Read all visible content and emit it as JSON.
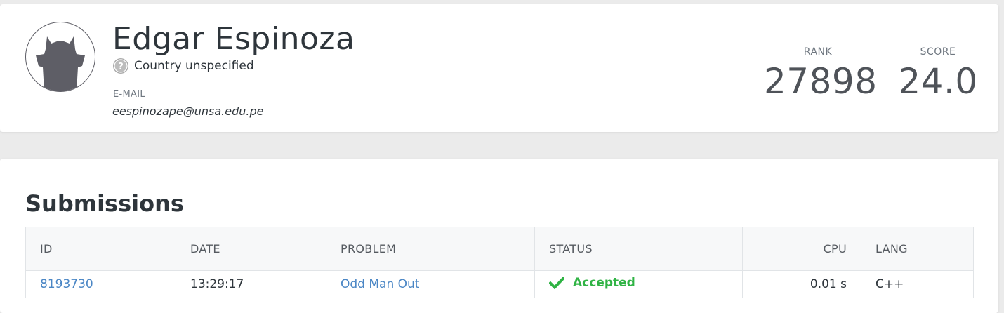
{
  "profile": {
    "name": "Edgar Espinoza",
    "country_text": "Country unspecified",
    "country_icon": "question-circle-icon",
    "email_label": "E-MAIL",
    "email": "eespinozape@unsa.edu.pe",
    "avatar_icon": "default-cat-avatar-icon"
  },
  "stats": {
    "rank_label": "RANK",
    "rank_value": "27898",
    "score_label": "SCORE",
    "score_value": "24.0"
  },
  "submissions": {
    "title": "Submissions",
    "columns": {
      "id": "ID",
      "date": "DATE",
      "problem": "PROBLEM",
      "status": "STATUS",
      "cpu": "CPU",
      "lang": "LANG"
    },
    "rows": [
      {
        "id": "8193730",
        "date": "13:29:17",
        "problem": "Odd Man Out",
        "status": "Accepted",
        "status_icon": "check-icon",
        "cpu": "0.01 s",
        "lang": "C++"
      }
    ]
  },
  "colors": {
    "accent_link": "#4a86c5",
    "accepted": "#2fb344",
    "background": "#ebebeb"
  }
}
